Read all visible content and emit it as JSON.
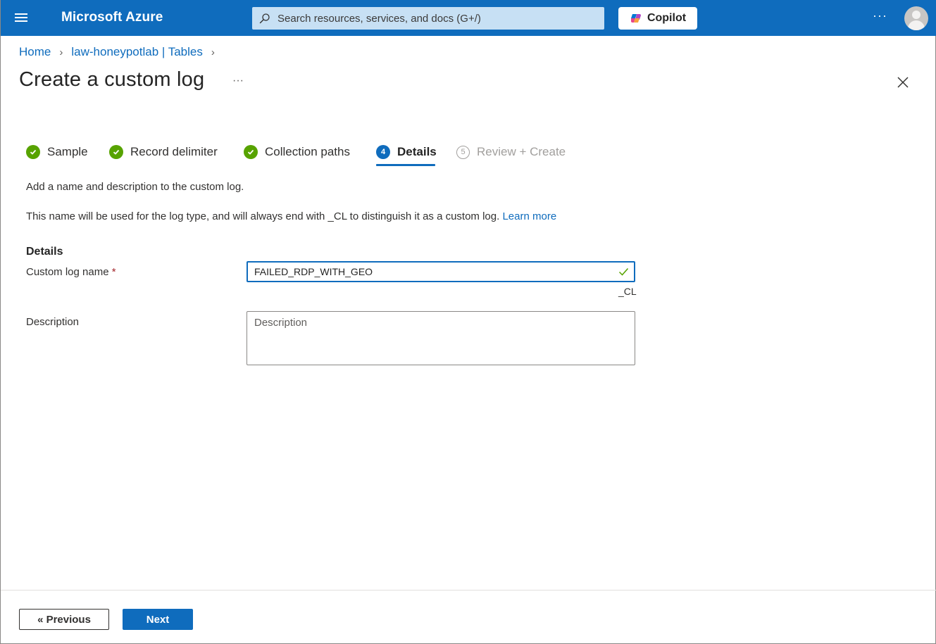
{
  "header": {
    "brand": "Microsoft Azure",
    "search_placeholder": "Search resources, services, and docs (G+/)",
    "copilot_label": "Copilot",
    "more_label": "···",
    "brand_color": "#0f6cbd"
  },
  "breadcrumb": {
    "items": [
      {
        "label": "Home"
      },
      {
        "label": "law-honeypotlab | Tables"
      }
    ]
  },
  "page": {
    "title": "Create a custom log",
    "more_label": "···"
  },
  "steps": [
    {
      "label": "Sample",
      "state": "complete"
    },
    {
      "label": "Record delimiter",
      "state": "complete"
    },
    {
      "label": "Collection paths",
      "state": "complete"
    },
    {
      "label": "Details",
      "state": "current",
      "number": "4"
    },
    {
      "label": "Review + Create",
      "state": "disabled",
      "number": "5"
    }
  ],
  "content": {
    "intro": "Add a name and description to the custom log.",
    "info": "This name will be used for the log type, and will always end with _CL to distinguish it as a custom log.",
    "learn_more": "Learn more",
    "section_title": "Details",
    "name_label": "Custom log name",
    "required_mark": "*",
    "name_value": "FAILED_RDP_WITH_GEO",
    "name_suffix": "_CL",
    "description_label": "Description",
    "description_placeholder": "Description",
    "description_value": ""
  },
  "footer": {
    "previous_label": "« Previous",
    "next_label": "Next"
  }
}
